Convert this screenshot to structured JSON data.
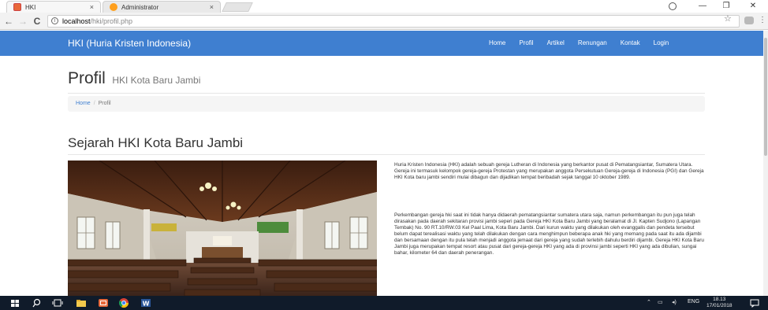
{
  "browser": {
    "tabs": [
      {
        "title": "HKI",
        "close": "×"
      },
      {
        "title": "Administrator",
        "close": "×"
      }
    ],
    "window_controls": {
      "minimize": "—",
      "maximize": "❐",
      "close": "✕"
    },
    "nav": {
      "back": "←",
      "forward": "→",
      "reload": "C"
    },
    "url_host": "localhost",
    "url_path": "/hki/profil.php"
  },
  "navbar": {
    "brand": "HKI (Huria Kristen Indonesia)",
    "links": [
      "Home",
      "Profil",
      "Artikel",
      "Renungan",
      "Kontak",
      "Login"
    ],
    "color": "#3f7fd0"
  },
  "page": {
    "title": "Profil",
    "subtitle": "HKI Kota Baru Jambi",
    "breadcrumb": {
      "home": "Home",
      "separator": "/",
      "current": "Profil"
    },
    "section_title": "Sejarah HKI Kota Baru Jambi",
    "paragraph1": "Huria Kristen Indonesia (HKI) adalah sebuah gereja Lutheran di Indonesia yang berkantor pusat di Pematangsiantar, Sumatera Utara. Gereja ini termasuk kelompok gereja-gereja Protestan yang merupakan anggota Persekutuan Gereja-gereja di Indonesia (PGI) dan Gereja HKI Kota baru jambi sendiri mulai dibagun dan dijadikan tempat beribadah sejak tanggal 10 oktober 1989.",
    "paragraph2": "Perkembangan gereja hki saat ini tidak hanya didaerah pematangsiantar sumatera utara saja, namun perkembangan itu pun juga telah dirasakan pada daerah sekitaran provisi jambi seperi pada Gereja HKI Kota Baru Jambi yang beralamat di Jl. Kapten Sudjono (Lapangan Tembak) No. 90 RT.10/RW.03 Kel Paal Lima, Kota Baru Jambi. Dari kurun waktu yang dilakukan oleh evanggalis dan pendeta tersebut belum dapat terealisasi waktu yang telah dilakukan dengan cara menghimpun beberapa anak hki yang memang pada saat itu ada dijambi dan bersamaan dengan itu pula telah menjadi anggota jemaat dari gereja yang sudah terlebih dahulu berdiri dijambi. Gereja HKI Kota Baru Jambi juga merupakan tempat resort atau pusat dari gereja-gereja HKI yang ada di provinsi jambi seperti HKI yang ada dibulian, sungai bahar, kilometer 64 dan daerah penerangan."
  },
  "taskbar": {
    "language": "ENG",
    "time": "18.13",
    "date": "17/01/2018"
  }
}
